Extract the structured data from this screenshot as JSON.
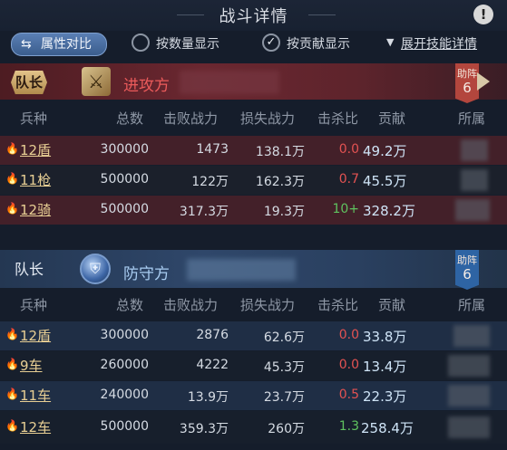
{
  "title": "战斗详情",
  "options": {
    "compare_label": "属性对比",
    "by_count_label": "按数量显示",
    "by_contribution_label": "按贡献显示",
    "by_count_checked": false,
    "by_contribution_checked": true,
    "expand_label": "展开技能详情"
  },
  "attacker": {
    "leader_badge": "队长",
    "side_label": "进攻方",
    "help_label": "助阵",
    "help_count": "6"
  },
  "defender": {
    "leader_badge": "队长",
    "side_label": "防守方",
    "help_label": "助阵",
    "help_count": "6"
  },
  "columns": [
    "兵种",
    "总数",
    "击败战力",
    "损失战力",
    "击杀比",
    "贡献",
    "所属"
  ],
  "attacker_rows": [
    {
      "troop": "12盾",
      "total": "300000",
      "defeated": "1473",
      "lost": "138.1万",
      "ratio": "0.0",
      "ratio_color": "red",
      "contrib": "49.2万"
    },
    {
      "troop": "11枪",
      "total": "500000",
      "defeated": "122万",
      "lost": "162.3万",
      "ratio": "0.7",
      "ratio_color": "red",
      "contrib": "45.5万"
    },
    {
      "troop": "12骑",
      "total": "500000",
      "defeated": "317.3万",
      "lost": "19.3万",
      "ratio": "10+",
      "ratio_color": "green",
      "contrib": "328.2万"
    }
  ],
  "defender_rows": [
    {
      "troop": "12盾",
      "total": "300000",
      "defeated": "2876",
      "lost": "62.6万",
      "ratio": "0.0",
      "ratio_color": "red",
      "contrib": "33.8万"
    },
    {
      "troop": "9车",
      "total": "260000",
      "defeated": "4222",
      "lost": "45.3万",
      "ratio": "0.0",
      "ratio_color": "red",
      "contrib": "13.4万"
    },
    {
      "troop": "11车",
      "total": "240000",
      "defeated": "13.9万",
      "lost": "23.7万",
      "ratio": "0.5",
      "ratio_color": "red",
      "contrib": "22.3万"
    },
    {
      "troop": "12车",
      "total": "500000",
      "defeated": "359.3万",
      "lost": "260万",
      "ratio": "1.3",
      "ratio_color": "green",
      "contrib": "258.4万"
    }
  ],
  "icons": {
    "fire": "🔥",
    "warning": "!",
    "swap": "⇆",
    "check": "✓",
    "swords": "⚔",
    "shield": "⛨",
    "triangle_down": "▼"
  }
}
